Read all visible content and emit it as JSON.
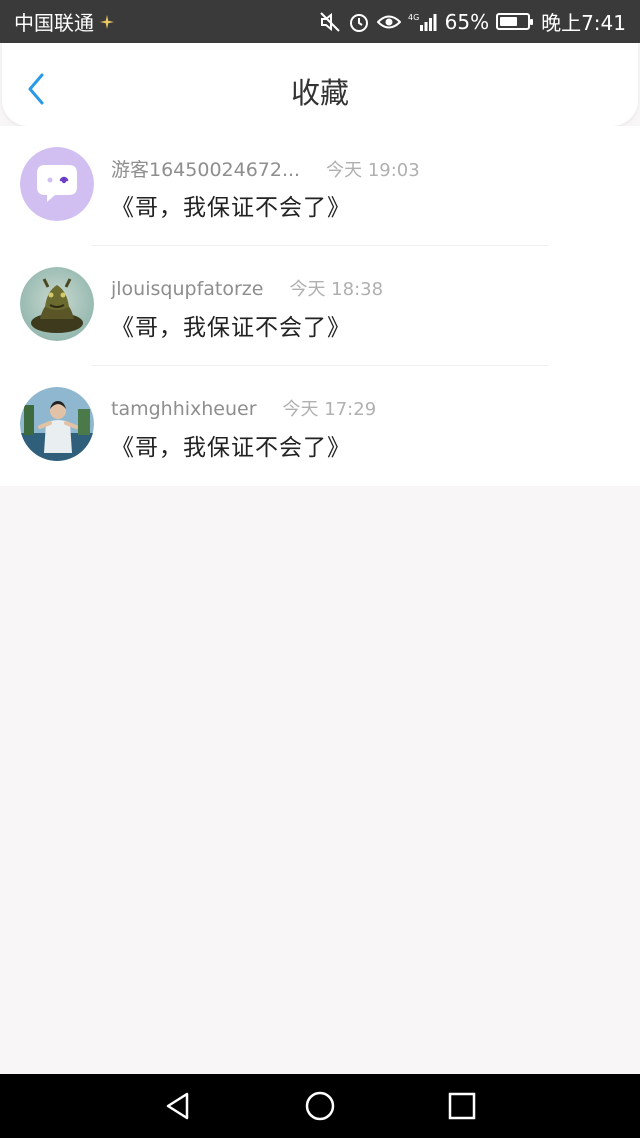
{
  "status_bar": {
    "carrier": "中国联通",
    "network": "4G",
    "battery": "65%",
    "battery_level": 0.65,
    "time": "晚上7:41"
  },
  "header": {
    "title": "收藏"
  },
  "favorites": [
    {
      "name": "游客16450024672...",
      "time": "今天 19:03",
      "content": "《哥，我保证不会了》"
    },
    {
      "name": "jlouisqupfatorze",
      "time": "今天 18:38",
      "content": "《哥，我保证不会了》"
    },
    {
      "name": "tamghhixheuer",
      "time": "今天 17:29",
      "content": "《哥，我保证不会了》"
    }
  ],
  "colors": {
    "accent": "#2a9ae8",
    "status_bar": "#3a3a3a",
    "background": "#f8f6f7"
  }
}
